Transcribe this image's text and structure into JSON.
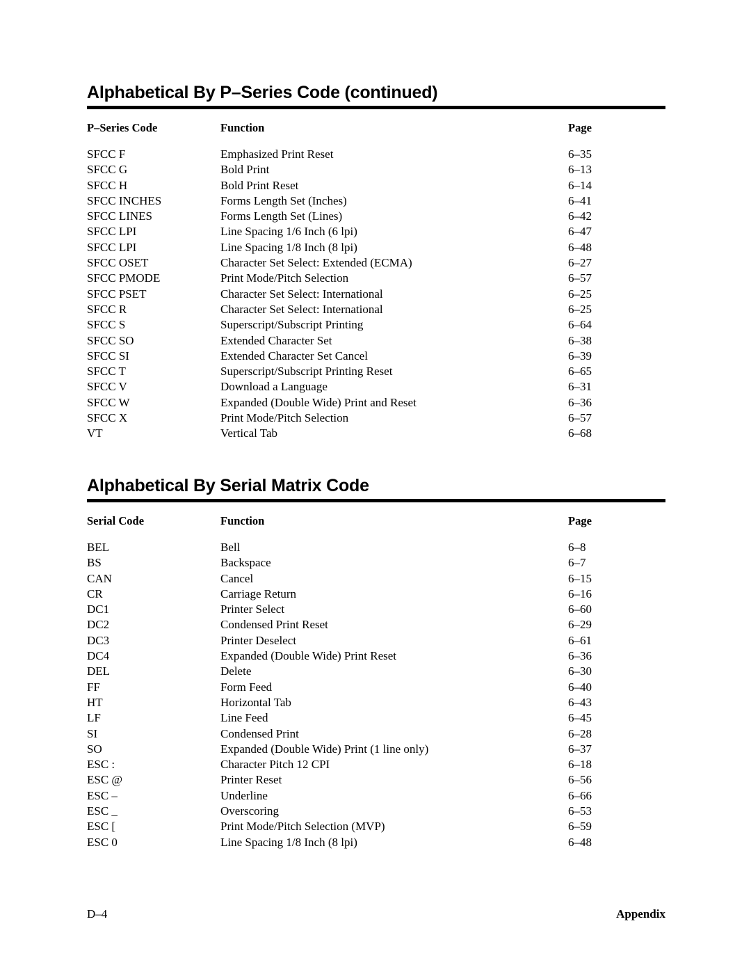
{
  "page": {
    "footer_left": "D–4",
    "footer_right": "Appendix"
  },
  "sections": [
    {
      "title": "Alphabetical By P–Series Code (continued)",
      "columns": {
        "code": "P–Series Code",
        "function": "Function",
        "page": "Page"
      },
      "rows": [
        {
          "code": "SFCC F",
          "function": "Emphasized Print Reset",
          "page": "6–35"
        },
        {
          "code": "SFCC G",
          "function": "Bold Print",
          "page": "6–13"
        },
        {
          "code": "SFCC H",
          "function": "Bold Print Reset",
          "page": "6–14"
        },
        {
          "code": "SFCC INCHES",
          "function": "Forms Length Set (Inches)",
          "page": "6–41"
        },
        {
          "code": "SFCC LINES",
          "function": "Forms Length Set (Lines)",
          "page": "6–42"
        },
        {
          "code": "SFCC LPI",
          "function": "Line Spacing 1/6 Inch (6 lpi)",
          "page": "6–47"
        },
        {
          "code": "SFCC LPI",
          "function": "Line Spacing 1/8 Inch (8 lpi)",
          "page": "6–48"
        },
        {
          "code": "SFCC OSET",
          "function": "Character Set Select: Extended (ECMA)",
          "page": "6–27"
        },
        {
          "code": "SFCC PMODE",
          "function": "Print Mode/Pitch Selection",
          "page": "6–57"
        },
        {
          "code": "SFCC PSET",
          "function": "Character Set Select: International",
          "page": "6–25"
        },
        {
          "code": "SFCC R",
          "function": "Character Set Select: International",
          "page": "6–25"
        },
        {
          "code": "SFCC S",
          "function": "Superscript/Subscript Printing",
          "page": "6–64"
        },
        {
          "code": "SFCC SO",
          "function": "Extended Character Set",
          "page": "6–38"
        },
        {
          "code": "SFCC SI",
          "function": "Extended Character Set Cancel",
          "page": "6–39"
        },
        {
          "code": "SFCC T",
          "function": "Superscript/Subscript Printing Reset",
          "page": "6–65"
        },
        {
          "code": "SFCC V",
          "function": "Download a Language",
          "page": "6–31"
        },
        {
          "code": "SFCC W",
          "function": "Expanded (Double Wide) Print and Reset",
          "page": "6–36"
        },
        {
          "code": "SFCC X",
          "function": "Print Mode/Pitch Selection",
          "page": "6–57"
        },
        {
          "code": "VT",
          "function": "Vertical Tab",
          "page": "6–68"
        }
      ]
    },
    {
      "title": "Alphabetical By Serial Matrix Code",
      "columns": {
        "code": "Serial Code",
        "function": "Function",
        "page": "Page"
      },
      "rows": [
        {
          "code": "BEL",
          "function": "Bell",
          "page": "6–8"
        },
        {
          "code": "BS",
          "function": "Backspace",
          "page": "6–7"
        },
        {
          "code": "CAN",
          "function": "Cancel",
          "page": "6–15"
        },
        {
          "code": "CR",
          "function": "Carriage Return",
          "page": "6–16"
        },
        {
          "code": "DC1",
          "function": "Printer Select",
          "page": "6–60"
        },
        {
          "code": "DC2",
          "function": "Condensed Print Reset",
          "page": "6–29"
        },
        {
          "code": "DC3",
          "function": "Printer Deselect",
          "page": "6–61"
        },
        {
          "code": "DC4",
          "function": "Expanded (Double Wide) Print Reset",
          "page": "6–36"
        },
        {
          "code": "DEL",
          "function": "Delete",
          "page": "6–30"
        },
        {
          "code": "FF",
          "function": "Form Feed",
          "page": "6–40"
        },
        {
          "code": "HT",
          "function": "Horizontal Tab",
          "page": "6–43"
        },
        {
          "code": "LF",
          "function": "Line Feed",
          "page": "6–45"
        },
        {
          "code": "SI",
          "function": "Condensed Print",
          "page": "6–28"
        },
        {
          "code": "SO",
          "function": "Expanded (Double Wide) Print (1 line only)",
          "page": "6–37"
        },
        {
          "code": "ESC :",
          "function": "Character Pitch 12 CPI",
          "page": "6–18"
        },
        {
          "code": "ESC @",
          "function": "Printer Reset",
          "page": "6–56"
        },
        {
          "code": "ESC –",
          "function": "Underline",
          "page": "6–66"
        },
        {
          "code": "ESC _",
          "function": "Overscoring",
          "page": "6–53"
        },
        {
          "code": "ESC [",
          "function": "Print Mode/Pitch Selection (MVP)",
          "page": "6–59"
        },
        {
          "code": "ESC 0",
          "function": "Line Spacing 1/8 Inch (8 lpi)",
          "page": "6–48"
        }
      ]
    }
  ]
}
